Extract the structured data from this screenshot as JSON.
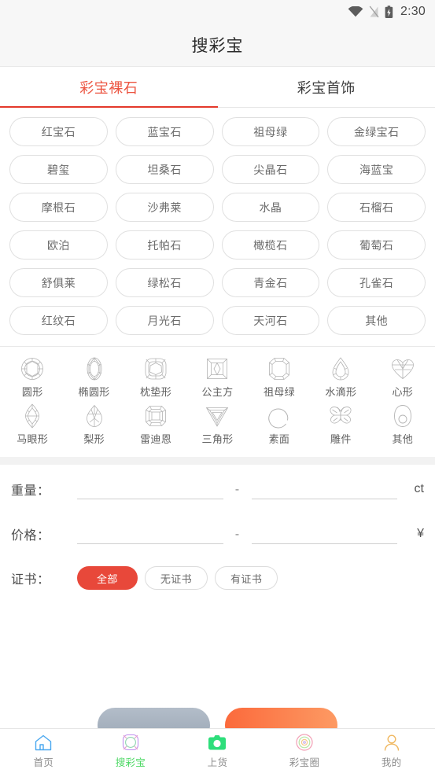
{
  "statusbar": {
    "time": "2:30",
    "wifi_icon": "wifi-icon",
    "signal_icon": "signal-off-icon",
    "battery_icon": "battery-charging-icon"
  },
  "header": {
    "title": "搜彩宝"
  },
  "tabs": [
    {
      "label": "彩宝裸石",
      "active": true
    },
    {
      "label": "彩宝首饰",
      "active": false
    }
  ],
  "colors": {
    "accent_red": "#e4392b",
    "tab_active_text": "#ec5541",
    "cert_selected_bg": "#e8483a",
    "nav_active": "#4bd863",
    "reset_button": "#a8b3c0",
    "confirm_button": "#fb6a3c"
  },
  "gem_chips": [
    "红宝石",
    "蓝宝石",
    "祖母绿",
    "金绿宝石",
    "碧玺",
    "坦桑石",
    "尖晶石",
    "海蓝宝",
    "摩根石",
    "沙弗莱",
    "水晶",
    "石榴石",
    "欧泊",
    "托帕石",
    "橄榄石",
    "葡萄石",
    "舒俱莱",
    "绿松石",
    "青金石",
    "孔雀石",
    "红纹石",
    "月光石",
    "天河石",
    "其他"
  ],
  "shapes": [
    {
      "label": "圆形",
      "icon": "round-cut-icon"
    },
    {
      "label": "椭圆形",
      "icon": "oval-cut-icon"
    },
    {
      "label": "枕垫形",
      "icon": "cushion-cut-icon"
    },
    {
      "label": "公主方",
      "icon": "princess-cut-icon"
    },
    {
      "label": "祖母绿",
      "icon": "emerald-cut-icon"
    },
    {
      "label": "水滴形",
      "icon": "pear-drop-cut-icon"
    },
    {
      "label": "心形",
      "icon": "heart-cut-icon"
    },
    {
      "label": "马眼形",
      "icon": "marquise-cut-icon"
    },
    {
      "label": "梨形",
      "icon": "pear-cut-icon"
    },
    {
      "label": "雷迪恩",
      "icon": "radiant-cut-icon"
    },
    {
      "label": "三角形",
      "icon": "trillion-cut-icon"
    },
    {
      "label": "素面",
      "icon": "cabochon-icon"
    },
    {
      "label": "雕件",
      "icon": "carving-butterfly-icon"
    },
    {
      "label": "其他",
      "icon": "other-shape-icon"
    }
  ],
  "form": {
    "weight": {
      "label": "重量：",
      "min_value": "",
      "min_placeholder": "",
      "separator": "-",
      "max_value": "",
      "max_placeholder": "",
      "unit": "ct"
    },
    "price": {
      "label": "价格：",
      "min_value": "",
      "min_placeholder": "",
      "separator": "-",
      "max_value": "",
      "max_placeholder": "",
      "unit": "¥"
    },
    "certificate": {
      "label": "证书：",
      "options": [
        {
          "label": "全部",
          "selected": true
        },
        {
          "label": "无证书",
          "selected": false
        },
        {
          "label": "有证书",
          "selected": false
        }
      ]
    }
  },
  "footer_actions": [
    {
      "name": "reset-button",
      "label": ""
    },
    {
      "name": "confirm-button",
      "label": ""
    }
  ],
  "bottomnav": [
    {
      "label": "首页",
      "icon": "home-icon",
      "active": false
    },
    {
      "label": "搜彩宝",
      "icon": "gem-search-icon",
      "active": true
    },
    {
      "label": "上货",
      "icon": "camera-upload-icon",
      "active": false
    },
    {
      "label": "彩宝圈",
      "icon": "community-rings-icon",
      "active": false
    },
    {
      "label": "我的",
      "icon": "profile-person-icon",
      "active": false
    }
  ]
}
